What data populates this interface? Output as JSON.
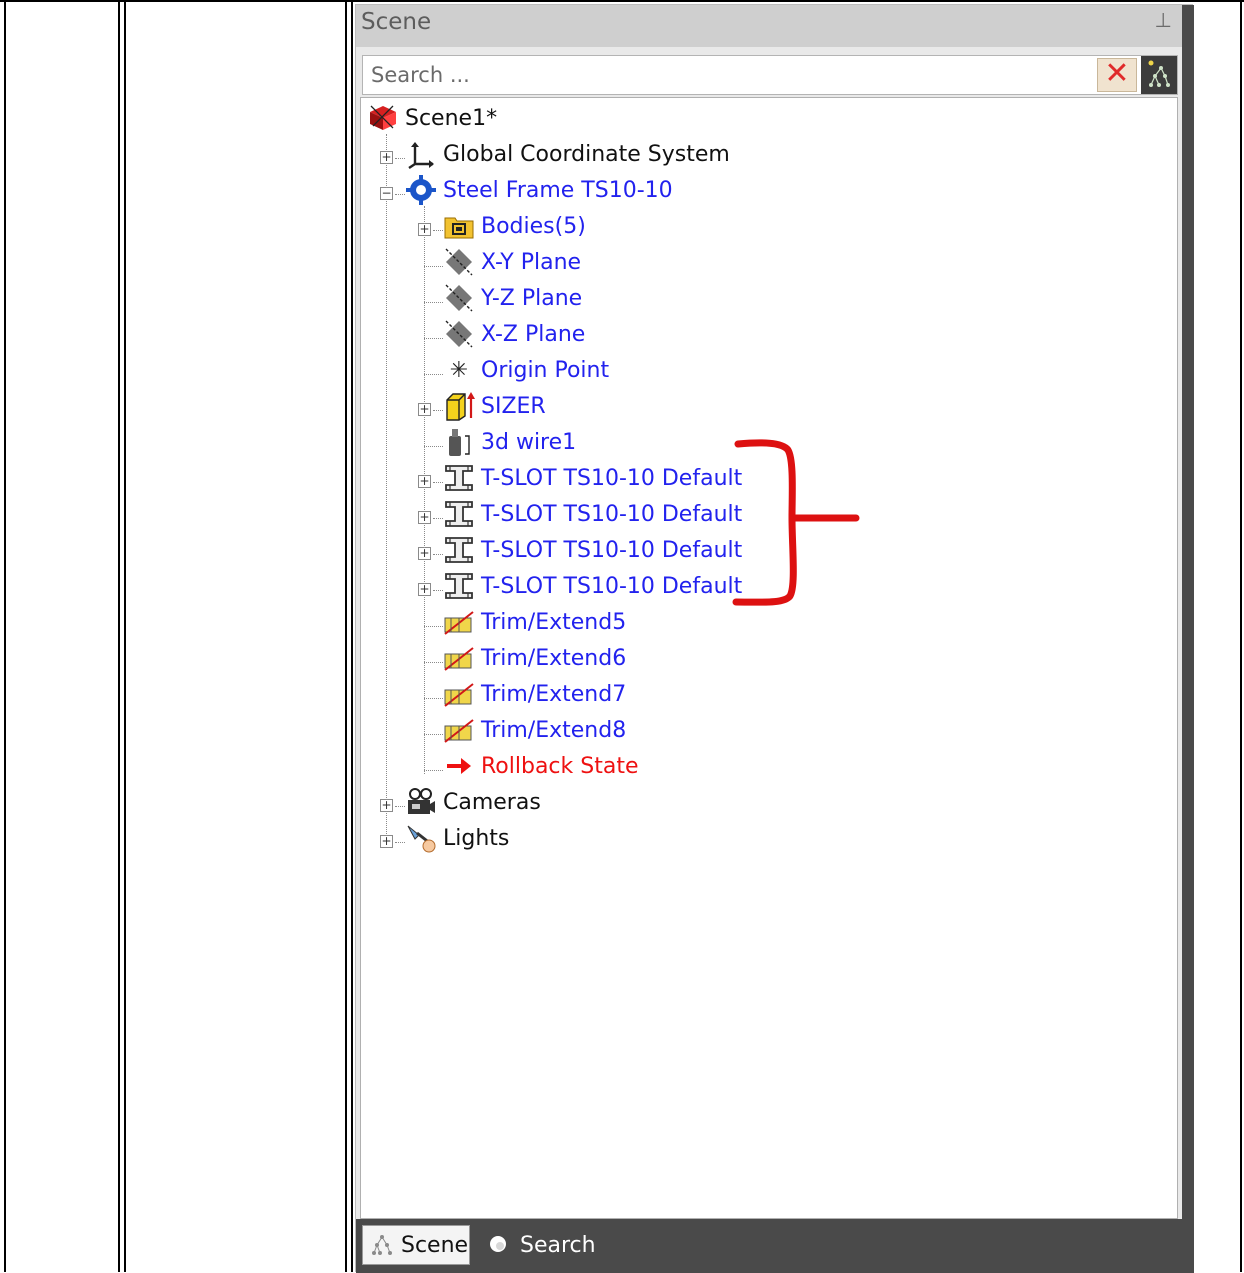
{
  "panel": {
    "title": "Scene",
    "pin_icon": "pin-icon",
    "search_placeholder": "Search ...",
    "clear_label": "✕"
  },
  "tree": {
    "root": "Scene1*",
    "items": [
      {
        "label": "Global Coordinate System",
        "icon": "coordinate-axes-icon",
        "color": "#111111"
      },
      {
        "label": "Steel Frame TS10-10",
        "icon": "gear-part-icon",
        "color": "#2222ee"
      },
      {
        "label": "Bodies(5)",
        "icon": "folder-icon",
        "color": "#2222ee"
      },
      {
        "label": "X-Y Plane",
        "icon": "plane-icon",
        "color": "#2222ee"
      },
      {
        "label": "Y-Z Plane",
        "icon": "plane-icon",
        "color": "#2222ee"
      },
      {
        "label": "X-Z Plane",
        "icon": "plane-icon",
        "color": "#2222ee"
      },
      {
        "label": "Origin Point",
        "icon": "origin-point-icon",
        "color": "#2222ee"
      },
      {
        "label": "SIZER",
        "icon": "sizer-icon",
        "color": "#2222ee"
      },
      {
        "label": "3d wire1",
        "icon": "wire-icon",
        "color": "#2222ee"
      },
      {
        "label": "T-SLOT TS10-10 Default",
        "icon": "tslot-profile-icon",
        "color": "#2222ee"
      },
      {
        "label": "T-SLOT TS10-10 Default",
        "icon": "tslot-profile-icon",
        "color": "#2222ee"
      },
      {
        "label": "T-SLOT TS10-10 Default",
        "icon": "tslot-profile-icon",
        "color": "#2222ee"
      },
      {
        "label": "T-SLOT TS10-10 Default",
        "icon": "tslot-profile-icon",
        "color": "#2222ee"
      },
      {
        "label": "Trim/Extend5",
        "icon": "trim-extend-icon",
        "color": "#2222ee"
      },
      {
        "label": "Trim/Extend6",
        "icon": "trim-extend-icon",
        "color": "#2222ee"
      },
      {
        "label": "Trim/Extend7",
        "icon": "trim-extend-icon",
        "color": "#2222ee"
      },
      {
        "label": "Trim/Extend8",
        "icon": "trim-extend-icon",
        "color": "#2222ee"
      },
      {
        "label": "Rollback State",
        "icon": "rollback-arrow-icon",
        "color": "#ee1111"
      },
      {
        "label": "Cameras",
        "icon": "camera-icon",
        "color": "#111111"
      },
      {
        "label": "Lights",
        "icon": "light-icon",
        "color": "#111111"
      }
    ]
  },
  "tabs": [
    {
      "label": "Scene",
      "active": true
    },
    {
      "label": "Search",
      "active": false
    }
  ],
  "annotation": {
    "color": "#dd1111",
    "description": "red bracket"
  }
}
